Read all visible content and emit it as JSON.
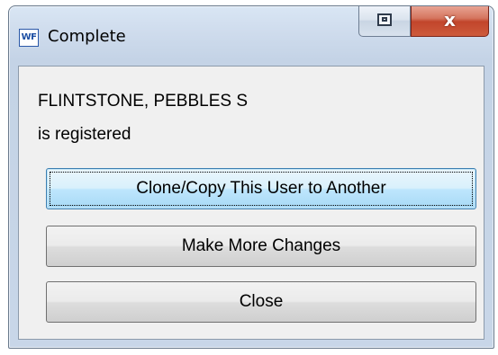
{
  "window": {
    "title": "Complete",
    "app_icon_text": "WF"
  },
  "titlebar_buttons": {
    "restore_icon": "restore-icon",
    "close_icon": "close-icon",
    "close_glyph": "x"
  },
  "message": {
    "name": "FLINTSTONE, PEBBLES S",
    "status": "is registered"
  },
  "buttons": {
    "clone_label": "Clone/Copy This User to Another",
    "more_changes_label": "Make More Changes",
    "close_label": "Close"
  },
  "colors": {
    "default_button_border": "#3c7fb1",
    "close_button_red": "#c2452b"
  }
}
